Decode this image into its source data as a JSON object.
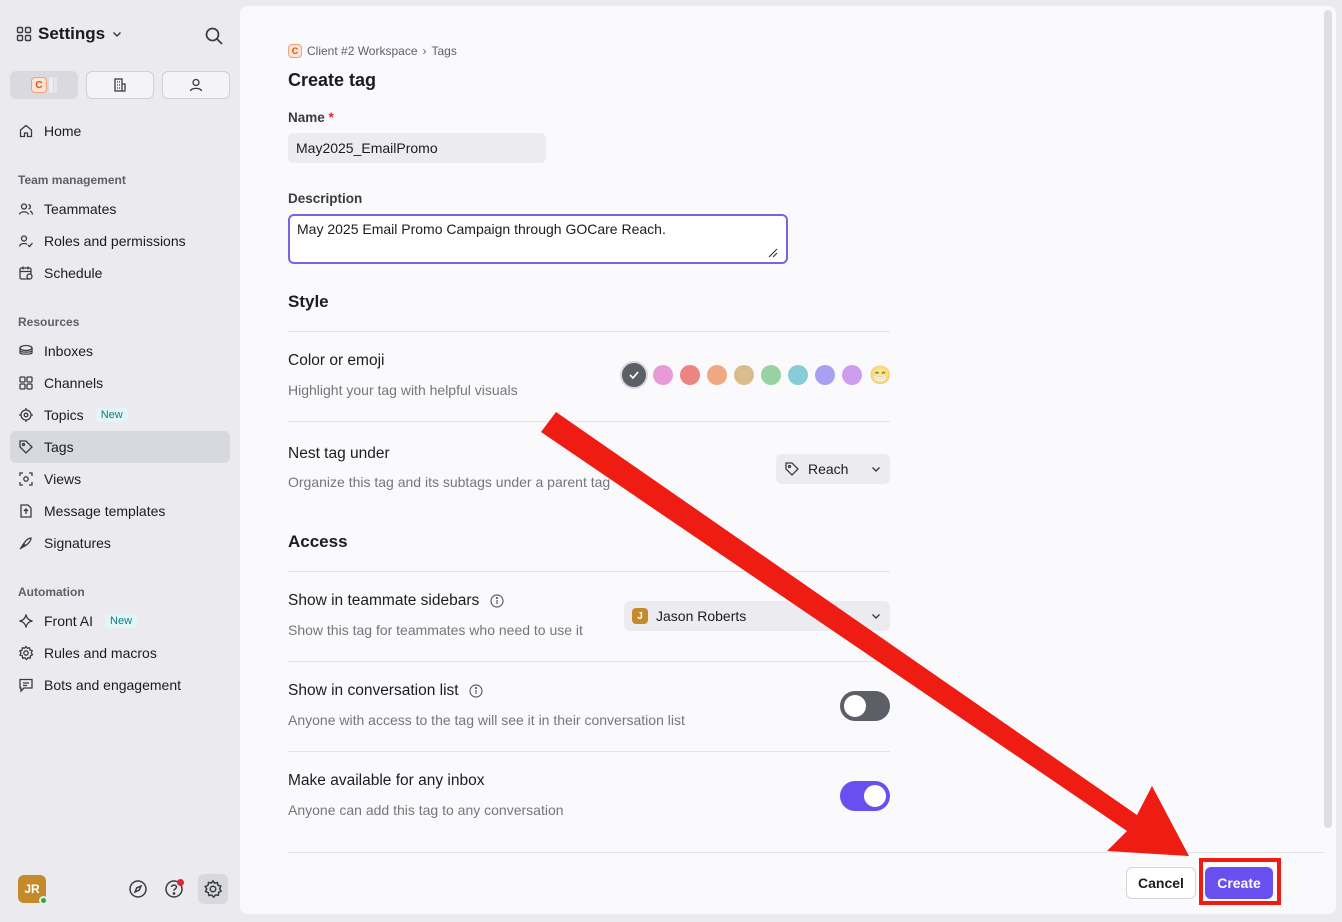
{
  "sidebar": {
    "title": "Settings",
    "scope_tabs": [
      {
        "name": "workspace",
        "badge": "C"
      },
      {
        "name": "company"
      },
      {
        "name": "personal"
      }
    ],
    "home": "Home",
    "sections": [
      {
        "label": "Team management",
        "items": [
          "Teammates",
          "Roles and permissions",
          "Schedule"
        ]
      },
      {
        "label": "Resources",
        "items": [
          "Inboxes",
          "Channels",
          "Topics",
          "Tags",
          "Views",
          "Message templates",
          "Signatures"
        ]
      },
      {
        "label": "Automation",
        "items": [
          "Front AI",
          "Rules and macros",
          "Bots and engagement"
        ]
      }
    ],
    "new_badge": "New",
    "active_item": "Tags",
    "user_initials": "JR"
  },
  "breadcrumb": {
    "badge": "C",
    "workspace": "Client #2 Workspace",
    "separator": "›",
    "current": "Tags"
  },
  "form": {
    "title": "Create tag",
    "name_label": "Name",
    "required_mark": "*",
    "name_value": "May2025_EmailPromo",
    "description_label": "Description",
    "description_value": "May 2025 Email Promo Campaign through GOCare Reach."
  },
  "style": {
    "title": "Style",
    "color_title": "Color or emoji",
    "color_desc": "Highlight your tag with helpful visuals",
    "swatches": [
      "#5d5f66",
      "#e89ad8",
      "#ec8484",
      "#f2a783",
      "#d9bd8e",
      "#98d2a3",
      "#88cbd9",
      "#a6a1f0",
      "#cf9df0"
    ],
    "emoji": "😁",
    "nest_title": "Nest tag under",
    "nest_desc": "Organize this tag and its subtags under a parent tag",
    "nest_value": "Reach"
  },
  "access": {
    "title": "Access",
    "sidebars_title": "Show in teammate sidebars",
    "sidebars_desc": "Show this tag for teammates who need to use it",
    "sidebars_value": "Jason Roberts",
    "sidebars_avatar": "J",
    "convo_title": "Show in conversation list",
    "convo_desc": "Anyone with access to the tag will see it in their conversation list",
    "convo_enabled": false,
    "inbox_title": "Make available for any inbox",
    "inbox_desc": "Anyone can add this tag to any conversation",
    "inbox_enabled": true
  },
  "actions": {
    "cancel": "Cancel",
    "create": "Create"
  },
  "colors": {
    "accent": "#6a4ff0",
    "annotation": "#ee1c12"
  }
}
